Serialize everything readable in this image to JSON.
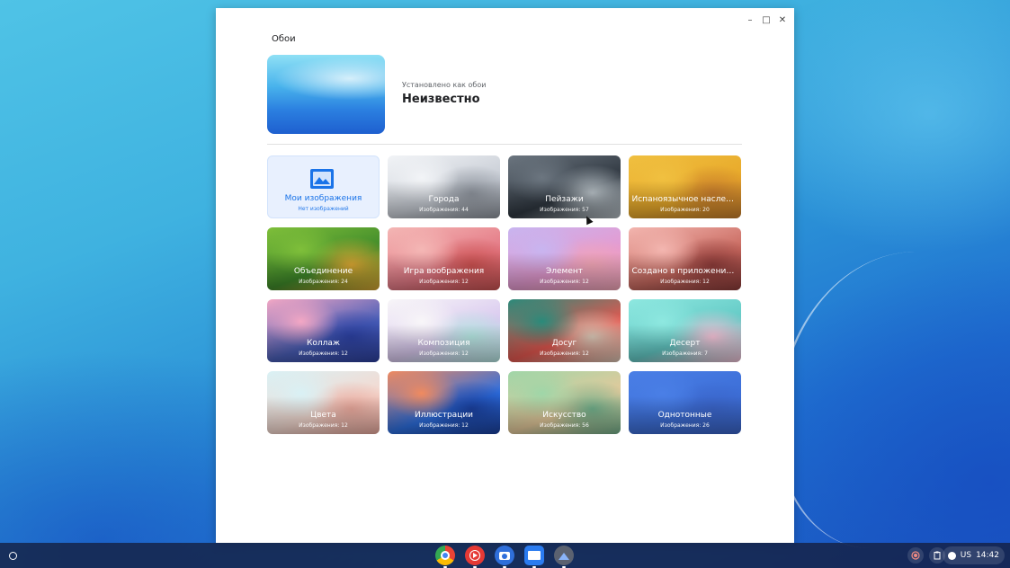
{
  "window": {
    "app_title": "Обои",
    "controls": {
      "minimize": "–",
      "maximize": "□",
      "close": "✕"
    }
  },
  "current": {
    "subtitle": "Установлено как обои",
    "title": "Неизвестно"
  },
  "collections": [
    {
      "name": "Мои изображения",
      "count": "Нет изображений",
      "style": "mine"
    },
    {
      "name": "Города",
      "count": "Изображения: 44",
      "colors": [
        "#f2f4f7",
        "#c9ced6",
        "#8d939c"
      ]
    },
    {
      "name": "Пейзажи",
      "count": "Изображения: 57",
      "colors": [
        "#6c7680",
        "#2f3740",
        "#b9c2c8"
      ]
    },
    {
      "name": "Испаноязычное наследие",
      "count": "Изображения: 20",
      "colors": [
        "#f0c040",
        "#e8a92a",
        "#c77d2c"
      ]
    },
    {
      "name": "Объединение",
      "count": "Изображения: 24",
      "colors": [
        "#7fbf3a",
        "#3f8a2a",
        "#d9a532"
      ]
    },
    {
      "name": "Игра воображения",
      "count": "Изображения: 12",
      "colors": [
        "#f4b7b5",
        "#e47a86",
        "#c9504f"
      ]
    },
    {
      "name": "Элемент",
      "count": "Изображения: 12",
      "colors": [
        "#c8b5f0",
        "#e59ad0",
        "#f2a6b6"
      ]
    },
    {
      "name": "Создано в приложении \"Хо...",
      "count": "Изображения: 12",
      "colors": [
        "#f3b6b0",
        "#c96a60",
        "#8a3a38"
      ]
    },
    {
      "name": "Коллаж",
      "count": "Изображения: 12",
      "colors": [
        "#f3a7c4",
        "#4a5fb8",
        "#2b3f9e"
      ]
    },
    {
      "name": "Композиция",
      "count": "Изображения: 12",
      "colors": [
        "#f8f6f8",
        "#d9c9ef",
        "#b3e6e0"
      ]
    },
    {
      "name": "Досуг",
      "count": "Изображения: 12",
      "colors": [
        "#2a8a7a",
        "#e4574f",
        "#d8c7b6"
      ]
    },
    {
      "name": "Десерт",
      "count": "Изображения: 7",
      "colors": [
        "#8ee8e0",
        "#63c9c5",
        "#f4c0d5"
      ]
    },
    {
      "name": "Цвета",
      "count": "Изображения: 12",
      "colors": [
        "#d9f1f5",
        "#f4d9d0",
        "#e8a79b"
      ]
    },
    {
      "name": "Иллюстрации",
      "count": "Изображения: 12",
      "colors": [
        "#f08a5f",
        "#2d6fe0",
        "#1a3f9c"
      ]
    },
    {
      "name": "Искусство",
      "count": "Изображения: 56",
      "colors": [
        "#9fd6a8",
        "#e4c99b",
        "#6fae8a"
      ]
    },
    {
      "name": "Однотонные",
      "count": "Изображения: 26",
      "colors": [
        "#4a7fe6",
        "#3d6fd8",
        "#3a64c8"
      ]
    }
  ],
  "taskbar": {
    "apps": [
      {
        "name": "chrome",
        "color": "#e8453c"
      },
      {
        "name": "youtube-music",
        "color": "#e53935"
      },
      {
        "name": "camera",
        "color": "#2f6fdb"
      },
      {
        "name": "files",
        "color": "#2b7cf0"
      },
      {
        "name": "wallpaper",
        "color": "#5b6270"
      }
    ],
    "keyboard_layout": "US",
    "time": "14:42"
  },
  "colors": {
    "accent": "#1a73e8",
    "window_bg": "#ffffff"
  }
}
